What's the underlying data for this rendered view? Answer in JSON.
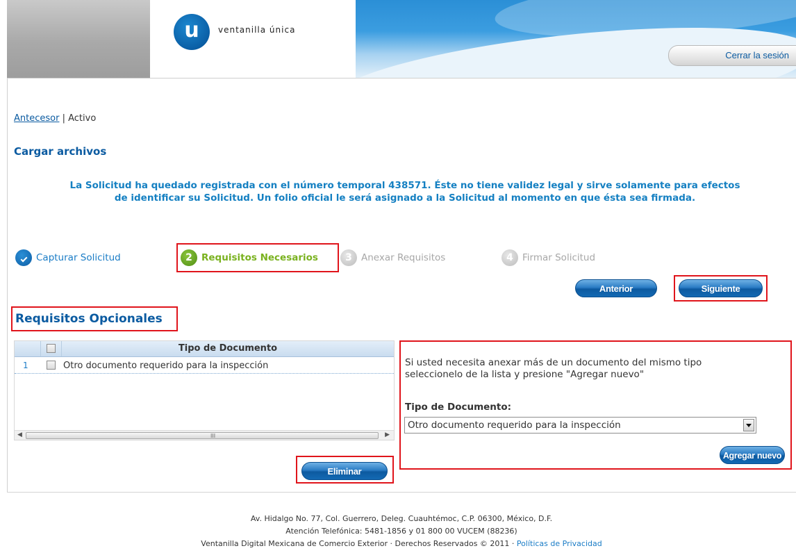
{
  "header": {
    "logo_letter": "u",
    "logo_text": "ventanilla única",
    "logout_label": "Cerrar la sesión"
  },
  "breadcrumb": {
    "link": "Antecesor",
    "separator": "|",
    "current": "Activo"
  },
  "page_title": "Cargar archivos",
  "notice": {
    "line1": "La Solicitud ha quedado registrada con el número temporal 438571. Éste no tiene validez legal y sirve solamente para efectos",
    "line2": "de identificar su Solicitud. Un folio oficial le será asignado a la Solicitud al momento en que ésta sea firmada."
  },
  "steps": [
    {
      "number": "",
      "label": "Capturar Solicitud",
      "state": "done"
    },
    {
      "number": "2",
      "label": "Requisitos Necesarios",
      "state": "active"
    },
    {
      "number": "3",
      "label": "Anexar Requisitos",
      "state": "pending"
    },
    {
      "number": "4",
      "label": "Firmar Solicitud",
      "state": "pending"
    }
  ],
  "nav_buttons": {
    "anterior": "Anterior",
    "siguiente": "Siguiente"
  },
  "section_title": "Requisitos Opcionales",
  "grid": {
    "header": "Tipo de Documento",
    "rows": [
      {
        "num": "1",
        "tipo": "Otro documento requerido para la inspección"
      }
    ],
    "scroll_grip": "III"
  },
  "delete_label": "Eliminar",
  "right_panel": {
    "info_line1": "Si usted necesita anexar más de un documento del mismo tipo",
    "info_line2": "seleccionelo de la lista y presione \"Agregar nuevo\"",
    "label": "Tipo de Documento:",
    "selected": "Otro documento requerido para la inspección",
    "add_label": "Agregar nuevo"
  },
  "footer": {
    "line1": "Av. Hidalgo No. 77, Col. Guerrero, Deleg. Cuauhtémoc, C.P. 06300, México, D.F.",
    "line2": "Atención Telefónica: 5481-1856 y 01 800 00 VUCEM (88236)",
    "line3": "Ventanilla Digital Mexicana de Comercio Exterior · Derechos Reservados © 2011 ·",
    "privacy_link": "Políticas de Privacidad"
  },
  "colors": {
    "brand_blue": "#0b5ba1",
    "step_green": "#7ab21f",
    "highlight_red": "#e0141b"
  }
}
